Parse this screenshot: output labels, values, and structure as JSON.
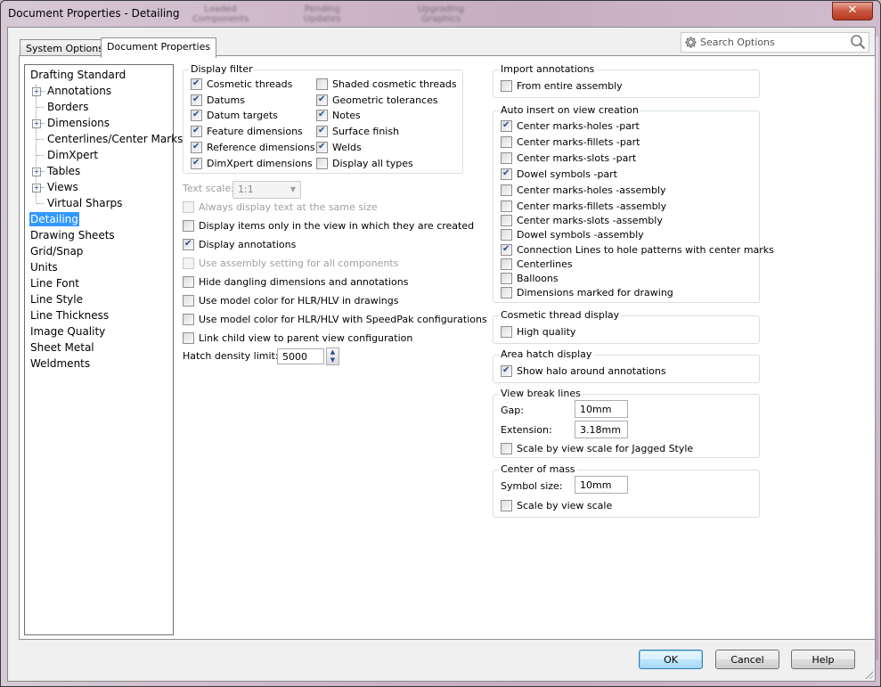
{
  "window": {
    "title": "Document Properties - Detailing",
    "background_ghost_labels": [
      "Loaded\nComponents",
      "Pending\nUpdates",
      "Upgrading\nGraphics"
    ],
    "close_glyph": "✕"
  },
  "tabs": [
    {
      "label": "System Options",
      "active": false
    },
    {
      "label": "Document Properties",
      "active": true
    }
  ],
  "search": {
    "placeholder": "Search Options",
    "icon": "gear-icon",
    "search_icon": "magnifier-icon"
  },
  "tree": {
    "items": [
      {
        "label": "Drafting Standard",
        "level": 0,
        "expandable": false,
        "selected": false
      },
      {
        "label": "Annotations",
        "level": 1,
        "expandable": true,
        "selected": false
      },
      {
        "label": "Borders",
        "level": 1,
        "expandable": false,
        "selected": false
      },
      {
        "label": "Dimensions",
        "level": 1,
        "expandable": true,
        "selected": false
      },
      {
        "label": "Centerlines/Center Marks",
        "level": 1,
        "expandable": false,
        "selected": false
      },
      {
        "label": "DimXpert",
        "level": 1,
        "expandable": false,
        "selected": false
      },
      {
        "label": "Tables",
        "level": 1,
        "expandable": true,
        "selected": false
      },
      {
        "label": "Views",
        "level": 1,
        "expandable": true,
        "selected": false
      },
      {
        "label": "Virtual Sharps",
        "level": 1,
        "expandable": false,
        "selected": false
      },
      {
        "label": "Detailing",
        "level": 0,
        "expandable": false,
        "selected": true
      },
      {
        "label": "Drawing Sheets",
        "level": 0,
        "expandable": false,
        "selected": false
      },
      {
        "label": "Grid/Snap",
        "level": 0,
        "expandable": false,
        "selected": false
      },
      {
        "label": "Units",
        "level": 0,
        "expandable": false,
        "selected": false
      },
      {
        "label": "Line Font",
        "level": 0,
        "expandable": false,
        "selected": false
      },
      {
        "label": "Line Style",
        "level": 0,
        "expandable": false,
        "selected": false
      },
      {
        "label": "Line Thickness",
        "level": 0,
        "expandable": false,
        "selected": false
      },
      {
        "label": "Image Quality",
        "level": 0,
        "expandable": false,
        "selected": false
      },
      {
        "label": "Sheet Metal",
        "level": 0,
        "expandable": false,
        "selected": false
      },
      {
        "label": "Weldments",
        "level": 0,
        "expandable": false,
        "selected": false
      }
    ]
  },
  "display_filter": {
    "title": "Display filter",
    "left": [
      {
        "label": "Cosmetic threads",
        "checked": true
      },
      {
        "label": "Datums",
        "checked": true
      },
      {
        "label": "Datum targets",
        "checked": true
      },
      {
        "label": "Feature dimensions",
        "checked": true
      },
      {
        "label": "Reference dimensions",
        "checked": true
      },
      {
        "label": "DimXpert dimensions",
        "checked": true
      }
    ],
    "right": [
      {
        "label": "Shaded cosmetic threads",
        "checked": false
      },
      {
        "label": "Geometric tolerances",
        "checked": true
      },
      {
        "label": "Notes",
        "checked": true
      },
      {
        "label": "Surface finish",
        "checked": true
      },
      {
        "label": "Welds",
        "checked": true
      },
      {
        "label": "Display all types",
        "checked": false
      }
    ]
  },
  "text_scale": {
    "label": "Text scale:",
    "value": "1:1",
    "enabled": false
  },
  "options": [
    {
      "label": "Always display text at the same size",
      "checked": false,
      "enabled": false
    },
    {
      "label": "Display items only in the view in which they are created",
      "checked": false,
      "enabled": true
    },
    {
      "label": "Display annotations",
      "checked": true,
      "enabled": true
    },
    {
      "label": "Use assembly setting for all components",
      "checked": false,
      "enabled": false
    },
    {
      "label": "Hide dangling dimensions and annotations",
      "checked": false,
      "enabled": true
    },
    {
      "label": "Use model color for HLR/HLV in drawings",
      "checked": false,
      "enabled": true
    },
    {
      "label": "Use model color for HLR/HLV with SpeedPak configurations",
      "checked": false,
      "enabled": true
    },
    {
      "label": "Link child view to parent view configuration",
      "checked": false,
      "enabled": true
    }
  ],
  "hatch_density": {
    "label": "Hatch density limit:",
    "value": "5000"
  },
  "import_annotations": {
    "title": "Import annotations",
    "items": [
      {
        "label": "From entire assembly",
        "checked": false
      }
    ]
  },
  "auto_insert": {
    "title": "Auto insert on view creation",
    "items": [
      {
        "label": "Center marks-holes -part",
        "checked": true
      },
      {
        "label": "Center marks-fillets -part",
        "checked": false
      },
      {
        "label": "Center marks-slots  -part",
        "checked": false
      },
      {
        "label": "Dowel symbols -part",
        "checked": true
      },
      {
        "label": "Center marks-holes -assembly",
        "checked": false
      },
      {
        "label": "Center marks-fillets -assembly",
        "checked": false
      },
      {
        "label": "Center marks-slots  -assembly",
        "checked": false
      },
      {
        "label": "Dowel symbols -assembly",
        "checked": false
      },
      {
        "label": "Connection Lines to hole patterns with center marks",
        "checked": true
      },
      {
        "label": "Centerlines",
        "checked": false
      },
      {
        "label": "Balloons",
        "checked": false
      },
      {
        "label": "Dimensions marked for drawing",
        "checked": false
      }
    ]
  },
  "cosmetic_thread_display": {
    "title": "Cosmetic thread display",
    "items": [
      {
        "label": "High quality",
        "checked": false
      }
    ]
  },
  "area_hatch_display": {
    "title": "Area hatch display",
    "items": [
      {
        "label": "Show halo around annotations",
        "checked": true
      }
    ]
  },
  "view_break_lines": {
    "title": "View break lines",
    "gap_label": "Gap:",
    "gap_value": "10mm",
    "extension_label": "Extension:",
    "extension_value": "3.18mm",
    "items": [
      {
        "label": "Scale by view scale for Jagged Style",
        "checked": false
      }
    ]
  },
  "center_of_mass": {
    "title": "Center of mass",
    "symbol_size_label": "Symbol size:",
    "symbol_size_value": "10mm",
    "items": [
      {
        "label": "Scale by view scale",
        "checked": false
      }
    ]
  },
  "buttons": {
    "ok": "OK",
    "cancel": "Cancel",
    "help": "Help"
  }
}
